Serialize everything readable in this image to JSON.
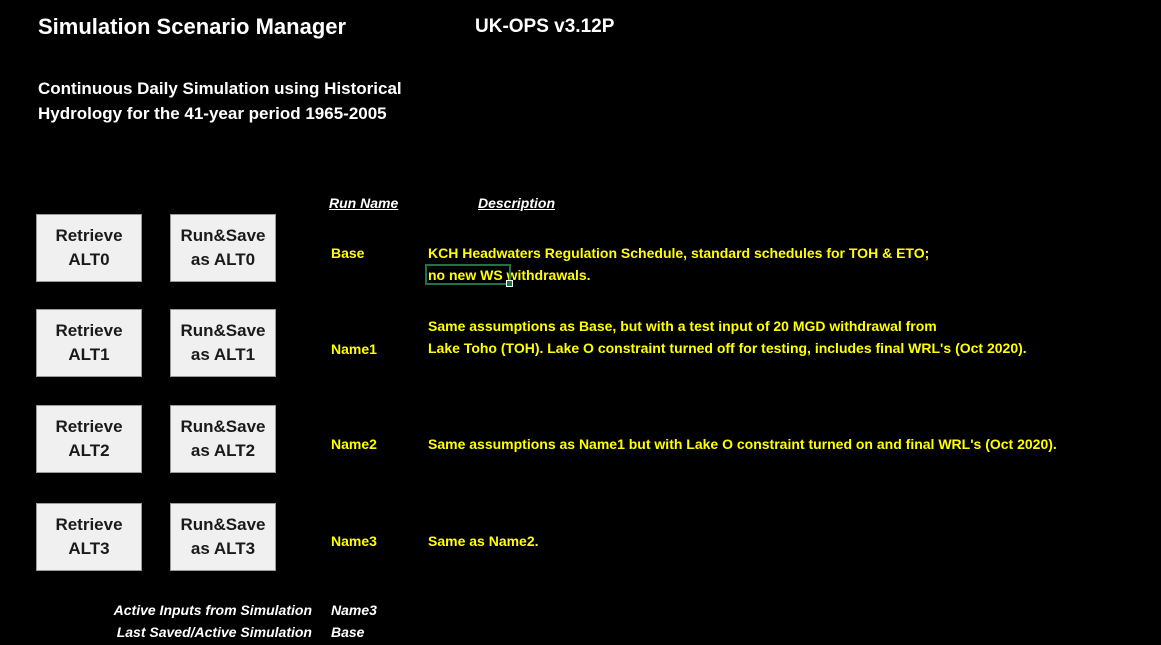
{
  "header": {
    "title": "Simulation Scenario Manager",
    "version": "UK-OPS v3.12P",
    "subtitle_line1": "Continuous Daily Simulation using Historical",
    "subtitle_line2": "Hydrology for the 41-year period 1965-2005"
  },
  "columns": {
    "run_name": "Run Name",
    "description": "Description"
  },
  "scenarios": [
    {
      "retrieve_label": "Retrieve\nALT0",
      "runsave_label": "Run&Save\nas ALT0",
      "run_name": "Base",
      "desc_line1": "KCH Headwaters Regulation Schedule, standard schedules for TOH & ETO;",
      "desc_line2": "no new WS withdrawals."
    },
    {
      "retrieve_label": "Retrieve\nALT1",
      "runsave_label": "Run&Save\nas ALT1",
      "run_name": "Name1",
      "desc_line1": "Same assumptions as Base, but with a test input of 20 MGD withdrawal from",
      "desc_line2": "Lake Toho (TOH).  Lake O constraint turned off for testing, includes final WRL's (Oct 2020)."
    },
    {
      "retrieve_label": "Retrieve\nALT2",
      "runsave_label": "Run&Save\nas ALT2",
      "run_name": "Name2",
      "desc_line1": "Same assumptions as Name1 but with Lake O constraint turned on and final WRL's (Oct 2020).",
      "desc_line2": ""
    },
    {
      "retrieve_label": "Retrieve\nALT3",
      "runsave_label": "Run&Save\nas ALT3",
      "run_name": "Name3",
      "desc_line1": "Same as Name2.",
      "desc_line2": ""
    }
  ],
  "status": {
    "active_inputs_label": "Active Inputs from Simulation",
    "active_inputs_value": "Name3",
    "last_saved_label": "Last Saved/Active Simulation",
    "last_saved_value": "Base"
  },
  "colors": {
    "background": "#000000",
    "accent_text": "#ffff00",
    "button_face": "#f0f0f0",
    "selection_border": "#217346"
  }
}
